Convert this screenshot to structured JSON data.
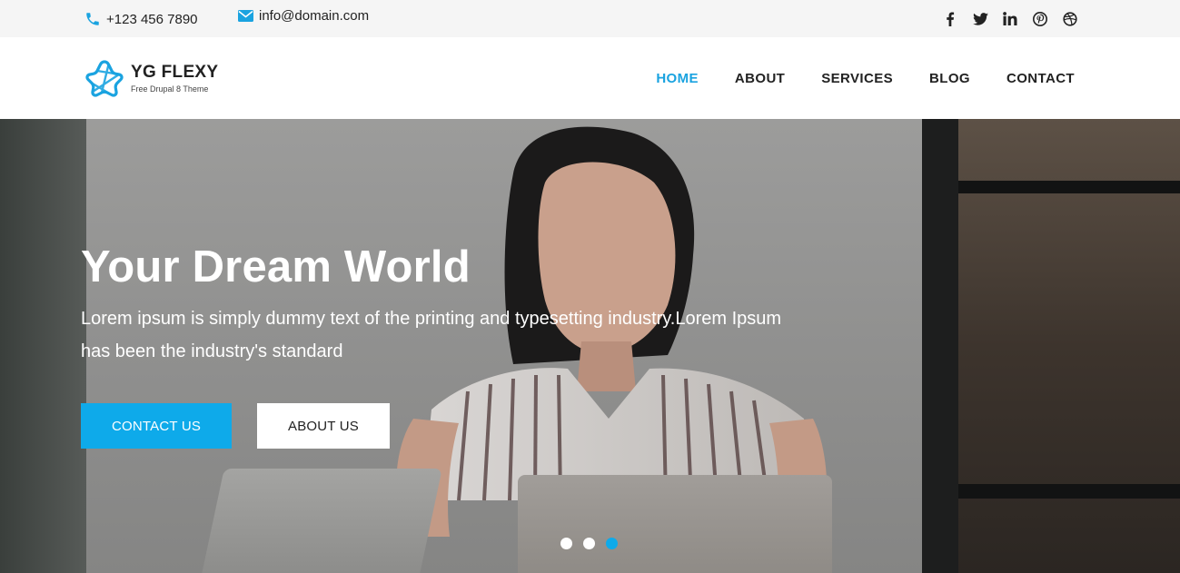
{
  "topbar": {
    "phone": "+123 456 7890",
    "email": "info@domain.com",
    "phone_icon": "phone-icon",
    "email_icon": "envelope-icon",
    "socials": [
      {
        "icon": "facebook-icon"
      },
      {
        "icon": "twitter-icon"
      },
      {
        "icon": "linkedin-icon"
      },
      {
        "icon": "pinterest-icon"
      },
      {
        "icon": "dribbble-icon"
      }
    ]
  },
  "header": {
    "logo_title": "YG FLEXY",
    "logo_subtitle": "Free Drupal 8 Theme",
    "nav": [
      {
        "label": "HOME",
        "active": true
      },
      {
        "label": "ABOUT",
        "active": false
      },
      {
        "label": "SERVICES",
        "active": false
      },
      {
        "label": "BLOG",
        "active": false
      },
      {
        "label": "CONTACT",
        "active": false
      }
    ]
  },
  "hero": {
    "title": "Your Dream World",
    "text": "Lorem ipsum is simply dummy text of the printing and typesetting industry.Lorem Ipsum has been the industry's standard",
    "primary_button": "CONTACT US",
    "secondary_button": "ABOUT US",
    "slides": 3,
    "active_slide": 3
  },
  "colors": {
    "accent": "#0eaaea",
    "nav_active": "#1aa3e0",
    "topbar_bg": "#f5f5f5",
    "text_dark": "#222222"
  }
}
